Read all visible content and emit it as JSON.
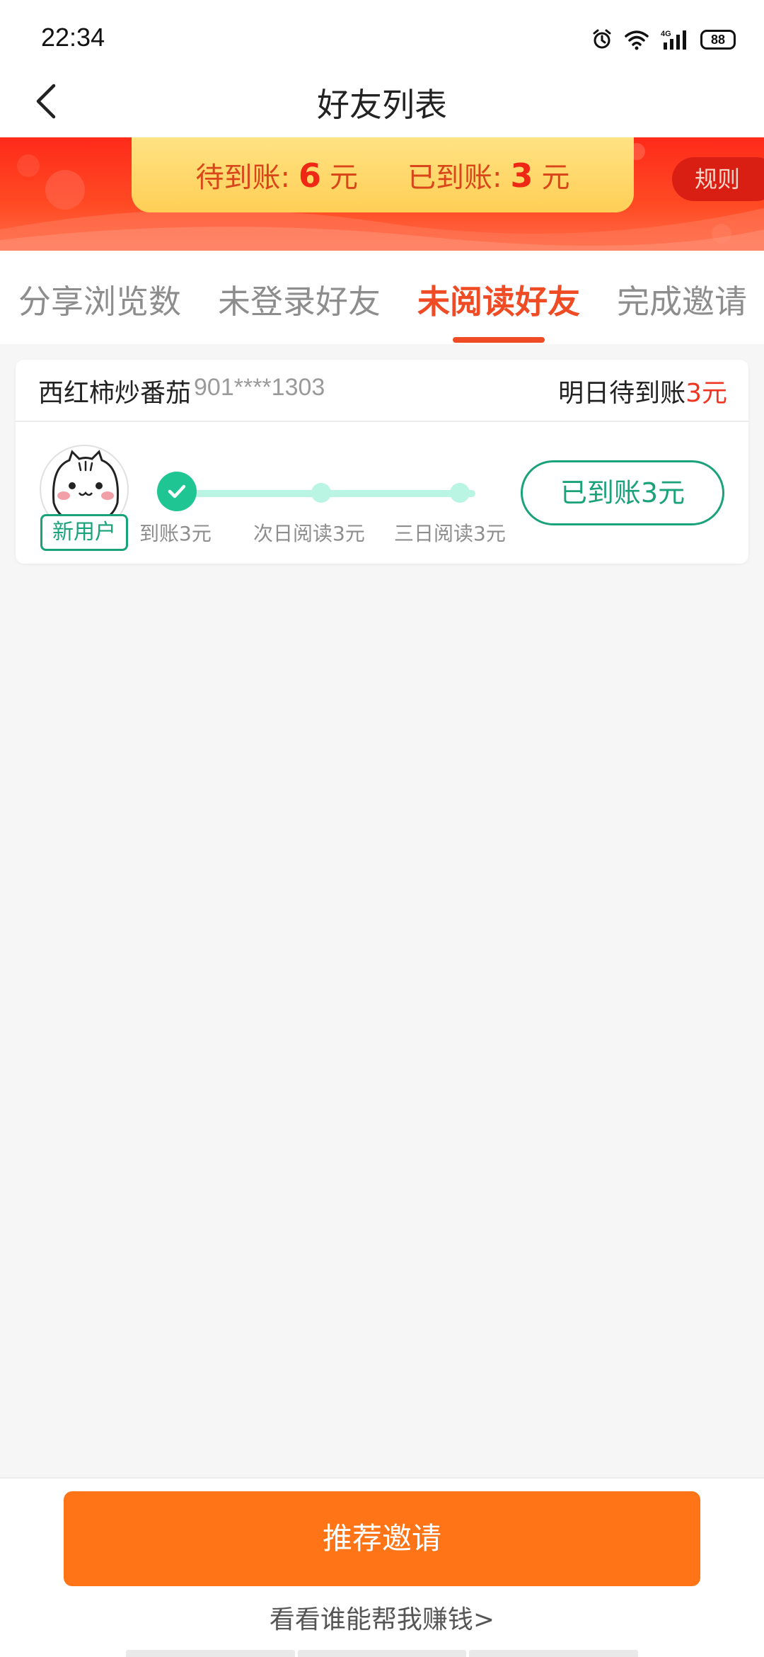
{
  "status_bar": {
    "time": "22:34",
    "battery": "88",
    "icons": [
      "alarm-icon",
      "wifi-icon",
      "signal-4g-icon",
      "battery-icon"
    ]
  },
  "nav": {
    "back_icon": "chevron-left-icon",
    "title": "好友列表"
  },
  "banner": {
    "pending_label": "待到账:",
    "pending_amount": "6",
    "pending_unit": "元",
    "received_label": "已到账:",
    "received_amount": "3",
    "received_unit": "元",
    "rules_label": "规则"
  },
  "tabs": [
    {
      "label": "分享浏览数",
      "active": false
    },
    {
      "label": "未登录好友",
      "active": false
    },
    {
      "label": "未阅读好友",
      "active": true
    },
    {
      "label": "完成邀请",
      "active": false
    }
  ],
  "friends": [
    {
      "name": "西红柿炒番茄",
      "phone": "901****1303",
      "pending_text": "明日待到账",
      "pending_amount": "3元",
      "badge": "新用户",
      "avatar_icon": "cat-avatar-icon",
      "steps": [
        "到账3元",
        "次日阅读3元",
        "三日阅读3元"
      ],
      "steps_completed": 1,
      "status_label": "已到账3元"
    }
  ],
  "bottom": {
    "invite_button": "推荐邀请",
    "link_text": "看看谁能帮我赚钱>"
  },
  "colors": {
    "accent": "#ef4b24",
    "invite_button": "#ff7416",
    "progress_green": "#1fc592",
    "badge_green": "#1aa27a",
    "banner_red": "#ff2a1a"
  }
}
